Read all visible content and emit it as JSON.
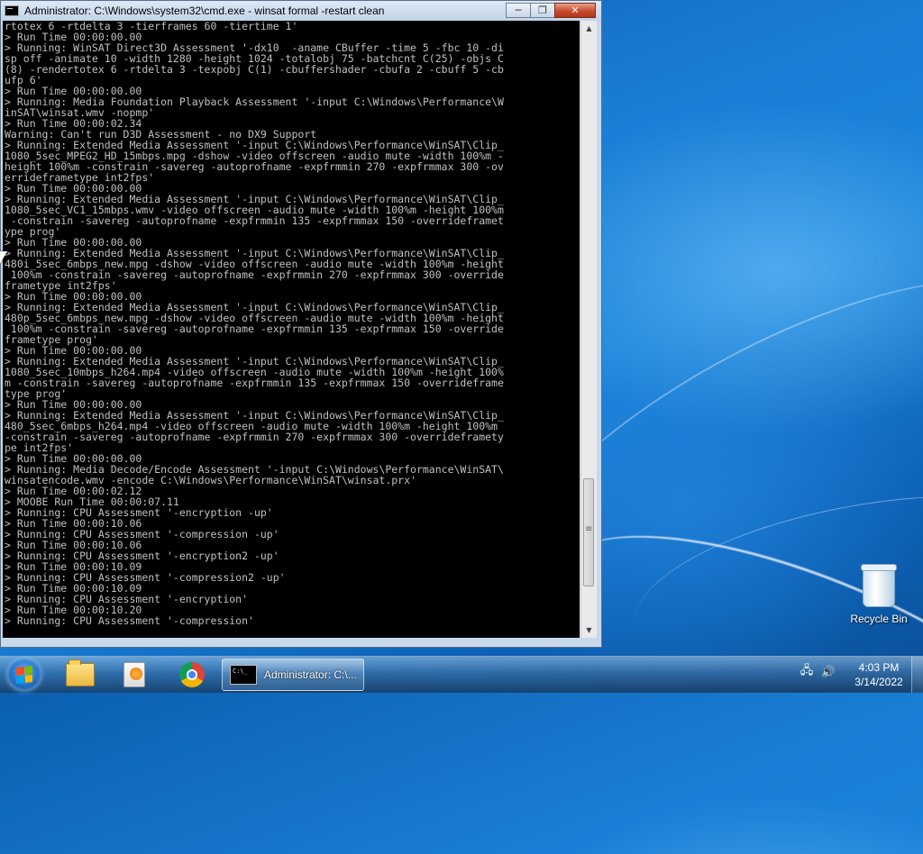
{
  "window": {
    "title": "Administrator: C:\\Windows\\system32\\cmd.exe - winsat  formal -restart clean",
    "controls": {
      "minimize_label": "─",
      "maximize_label": "❐",
      "close_label": "✕"
    }
  },
  "console": {
    "lines": [
      "rtotex 6 -rtdelta 3 -tierframes 60 -tiertime 1'",
      "> Run Time 00:00:00.00",
      "> Running: WinSAT Direct3D Assessment '-dx10  -aname CBuffer -time 5 -fbc 10 -di",
      "sp off -animate 10 -width 1280 -height 1024 -totalobj 75 -batchcnt C(25) -objs C",
      "(8) -rendertotex 6 -rtdelta 3 -texpobj C(1) -cbuffershader -cbufa 2 -cbuff 5 -cb",
      "ufp 6'",
      "> Run Time 00:00:00.00",
      "> Running: Media Foundation Playback Assessment '-input C:\\Windows\\Performance\\W",
      "inSAT\\winsat.wmv -nopmp'",
      "> Run Time 00:00:02.34",
      "Warning: Can't run D3D Assessment - no DX9 Support",
      "> Running: Extended Media Assessment '-input C:\\Windows\\Performance\\WinSAT\\Clip_",
      "1080_5sec_MPEG2_HD_15mbps.mpg -dshow -video offscreen -audio mute -width 100%m -",
      "height 100%m -constrain -savereg -autoprofname -expfrmmin 270 -expfrmmax 300 -ov",
      "errideframetype int2fps'",
      "> Run Time 00:00:00.00",
      "> Running: Extended Media Assessment '-input C:\\Windows\\Performance\\WinSAT\\Clip_",
      "1080_5sec_VC1_15mbps.wmv -video offscreen -audio mute -width 100%m -height 100%m",
      " -constrain -savereg -autoprofname -expfrmmin 135 -expfrmmax 150 -overrideframet",
      "ype prog'",
      "> Run Time 00:00:00.00",
      "> Running: Extended Media Assessment '-input C:\\Windows\\Performance\\WinSAT\\Clip_",
      "480i_5sec_6mbps_new.mpg -dshow -video offscreen -audio mute -width 100%m -height",
      " 100%m -constrain -savereg -autoprofname -expfrmmin 270 -expfrmmax 300 -override",
      "frametype int2fps'",
      "> Run Time 00:00:00.00",
      "> Running: Extended Media Assessment '-input C:\\Windows\\Performance\\WinSAT\\Clip_",
      "480p_5sec_6mbps_new.mpg -dshow -video offscreen -audio mute -width 100%m -height",
      " 100%m -constrain -savereg -autoprofname -expfrmmin 135 -expfrmmax 150 -override",
      "frametype prog'",
      "> Run Time 00:00:00.00",
      "> Running: Extended Media Assessment '-input C:\\Windows\\Performance\\WinSAT\\Clip_",
      "1080_5sec_10mbps_h264.mp4 -video offscreen -audio mute -width 100%m -height 100%",
      "m -constrain -savereg -autoprofname -expfrmmin 135 -expfrmmax 150 -overrideframe",
      "type prog'",
      "> Run Time 00:00:00.00",
      "> Running: Extended Media Assessment '-input C:\\Windows\\Performance\\WinSAT\\Clip_",
      "480_5sec_6mbps_h264.mp4 -video offscreen -audio mute -width 100%m -height 100%m",
      "-constrain -savereg -autoprofname -expfrmmin 270 -expfrmmax 300 -overrideframety",
      "pe int2fps'",
      "> Run Time 00:00:00.00",
      "> Running: Media Decode/Encode Assessment '-input C:\\Windows\\Performance\\WinSAT\\",
      "winsatencode.wmv -encode C:\\Windows\\Performance\\WinSAT\\winsat.prx'",
      "> Run Time 00:00:02.12",
      "> MOOBE Run Time 00:00:07.11",
      "> Running: CPU Assessment '-encryption -up'",
      "> Run Time 00:00:10.06",
      "> Running: CPU Assessment '-compression -up'",
      "> Run Time 00:00:10.06",
      "> Running: CPU Assessment '-encryption2 -up'",
      "> Run Time 00:00:10.09",
      "> Running: CPU Assessment '-compression2 -up'",
      "> Run Time 00:00:10.09",
      "> Running: CPU Assessment '-encryption'",
      "> Run Time 00:00:10.20",
      "> Running: CPU Assessment '-compression'"
    ]
  },
  "scrollbar": {
    "up_arrow": "▲",
    "down_arrow": "▼",
    "position_fraction": 0.93
  },
  "desktop": {
    "icons": [
      {
        "label": "Recycle Bin",
        "icon": "recycle-bin-icon"
      }
    ]
  },
  "taskbar": {
    "start_icon": "windows-logo-icon",
    "pinned": [
      {
        "name": "Windows Explorer",
        "icon": "folder-icon"
      },
      {
        "name": "Windows Media Player",
        "icon": "media-player-icon"
      },
      {
        "name": "Google Chrome",
        "icon": "chrome-icon"
      }
    ],
    "active_task": {
      "label": "Administrator: C:\\...",
      "icon": "cmd-icon"
    },
    "tray": {
      "network_icon": "network-icon",
      "volume_icon": "volume-icon",
      "network_glyph": "🖧",
      "volume_glyph": "🔊"
    },
    "clock": {
      "time": "4:03 PM",
      "date": "3/14/2022"
    }
  }
}
